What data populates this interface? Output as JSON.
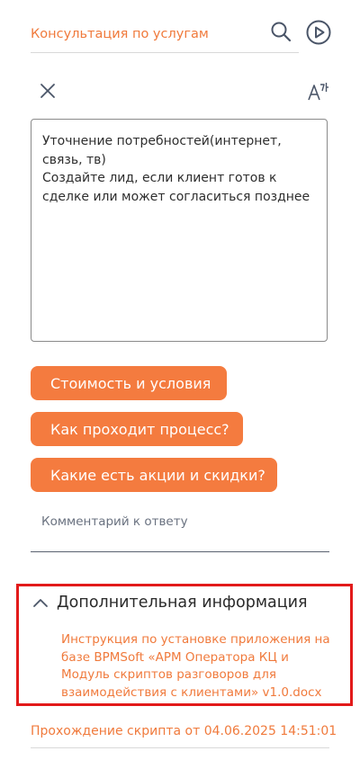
{
  "header": {
    "title": "Консультация по услугам",
    "search_icon": "search-icon",
    "play_icon": "play-circle-icon"
  },
  "toolbar": {
    "close_icon": "close-icon",
    "font_size_icon": "font-size-icon"
  },
  "script": {
    "lines": [
      "Уточнение потребностей(интернет, связь, тв)",
      "Создайте лид, если клиент готов к сделке или может согласиться позднее"
    ]
  },
  "answers": [
    {
      "label": "Стоимость и условия"
    },
    {
      "label": "Как проходит процесс?"
    },
    {
      "label": "Какие есть акции и скидки?"
    }
  ],
  "comment": {
    "placeholder": "Комментарий к ответу"
  },
  "info": {
    "title": "Дополнительная информация",
    "expanded": true,
    "link_text": "Инструкция по установке приложения на базе BPMSoft «АРМ Оператора КЦ и Модуль скриптов разговоров для взаимодействия с клиентами» v1.0.docx"
  },
  "footer": {
    "text": "Прохождение скрипта от 04.06.2025 14:51:01"
  },
  "colors": {
    "accent": "#f47b3f",
    "highlight_border": "#e21a1a"
  }
}
